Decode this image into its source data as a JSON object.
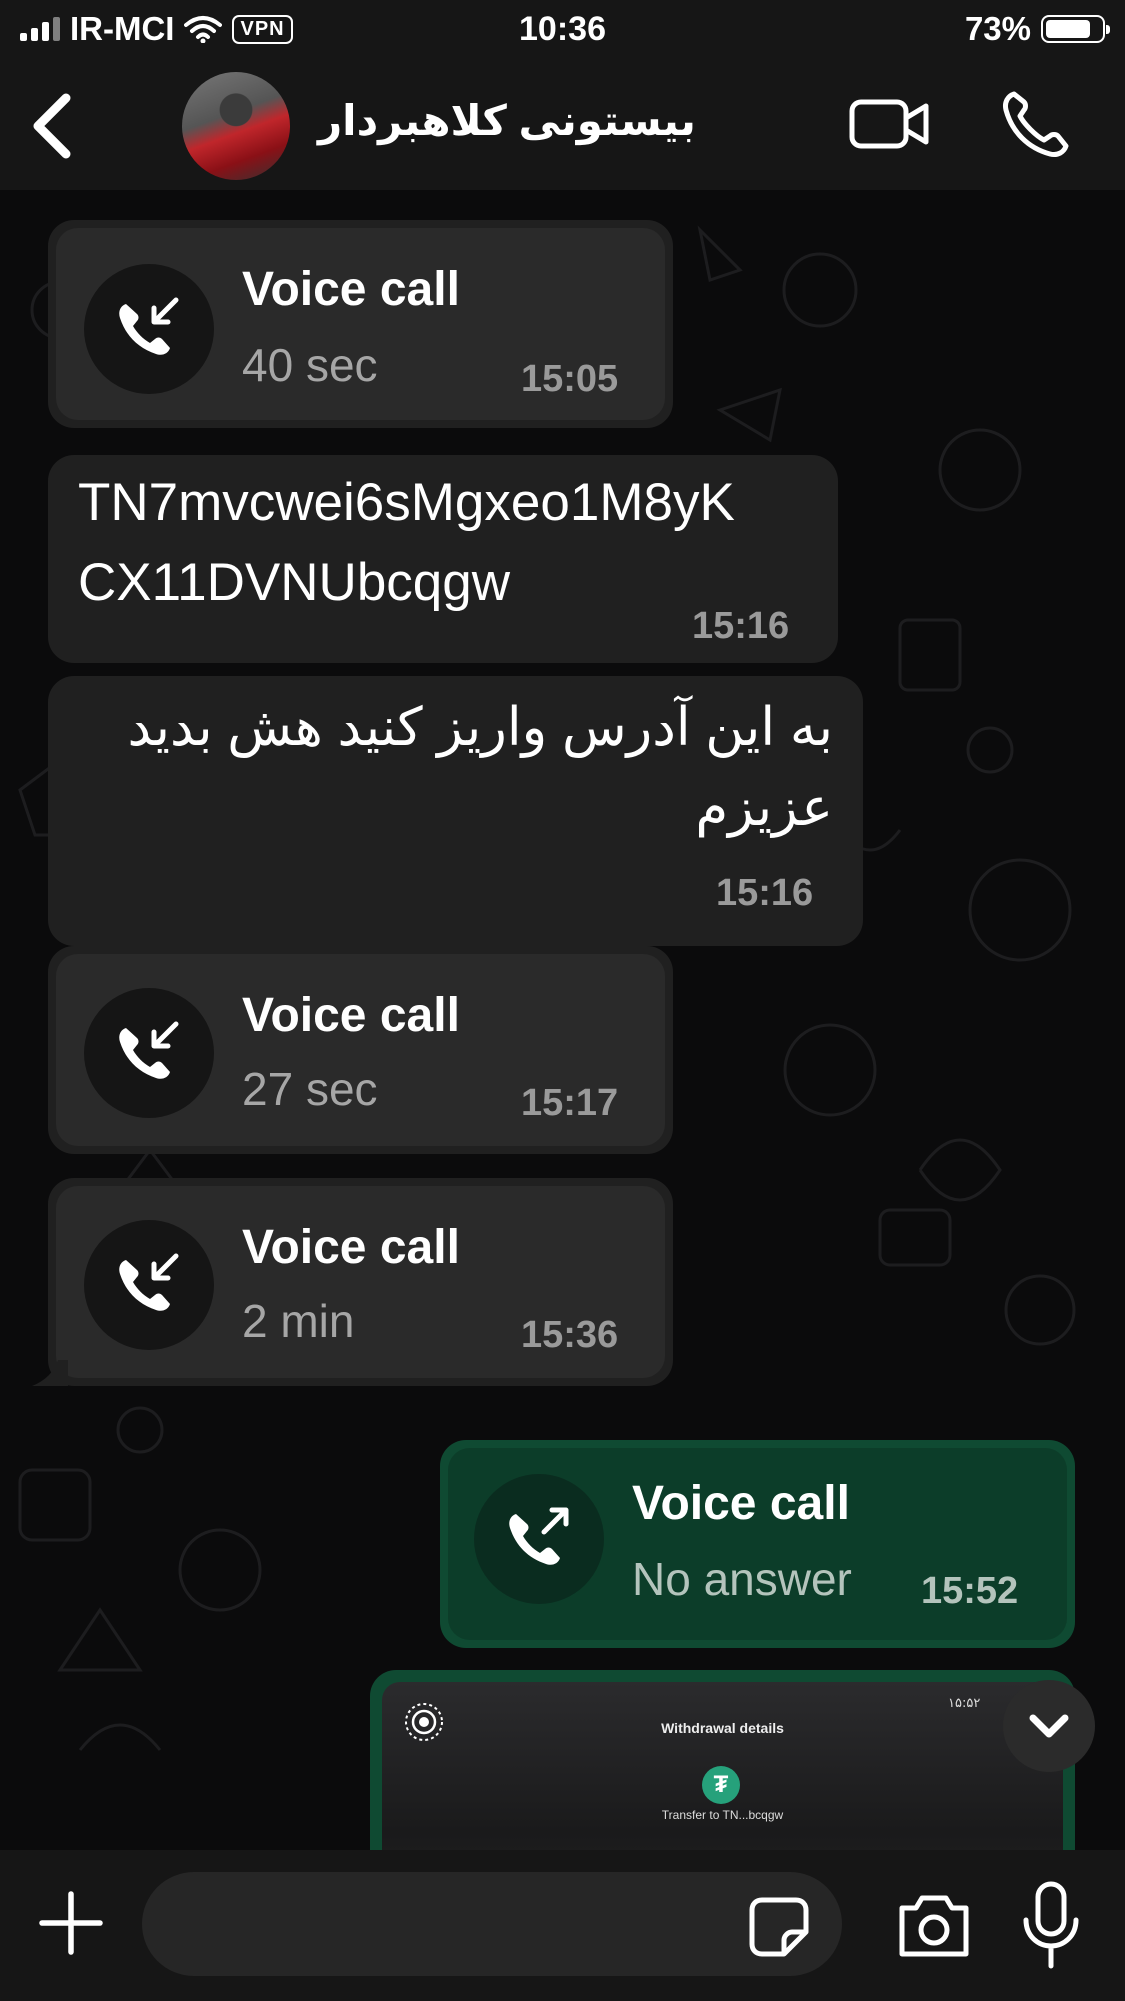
{
  "status_bar": {
    "carrier": "IR-MCI",
    "vpn": "VPN",
    "time": "10:36",
    "battery_percent": "73%",
    "battery_level": 0.73
  },
  "header": {
    "contact_name": "بیستونی کلاهبردار",
    "back_icon": "chevron-left-icon",
    "video_icon": "video-camera-icon",
    "call_icon": "phone-icon"
  },
  "messages": [
    {
      "type": "call",
      "direction": "incoming",
      "title": "Voice call",
      "detail": "40 sec",
      "time": "15:05"
    },
    {
      "type": "text",
      "direction": "incoming",
      "lines": [
        "TN7mvcwei6sMgxeo1M8yK",
        "CX11DVNUbcqgw"
      ],
      "time": "15:16"
    },
    {
      "type": "text",
      "direction": "incoming",
      "lines": [
        "به این آدرس واریز کنید هش بدید",
        "عزیزم"
      ],
      "time": "15:16"
    },
    {
      "type": "call",
      "direction": "incoming",
      "title": "Voice call",
      "detail": "27 sec",
      "time": "15:17"
    },
    {
      "type": "call",
      "direction": "incoming",
      "title": "Voice call",
      "detail": "2 min",
      "time": "15:36"
    },
    {
      "type": "call",
      "direction": "outgoing",
      "title": "Voice call",
      "detail": "No answer",
      "time": "15:52"
    },
    {
      "type": "image",
      "direction": "outgoing",
      "screenshot_texts": {
        "title": "Withdrawal details",
        "transfer": "Transfer to TN...bcqgw",
        "status_time": "۱۵:۵۲"
      }
    }
  ],
  "composer": {
    "placeholder": "",
    "plus_icon": "plus-icon",
    "sticker_icon": "sticker-icon",
    "camera_icon": "camera-icon",
    "mic_icon": "microphone-icon"
  },
  "colors": {
    "incoming_bubble": "#202020",
    "outgoing_bubble": "#0f4a32",
    "background": "#0b0b0c",
    "bar": "#161616"
  }
}
